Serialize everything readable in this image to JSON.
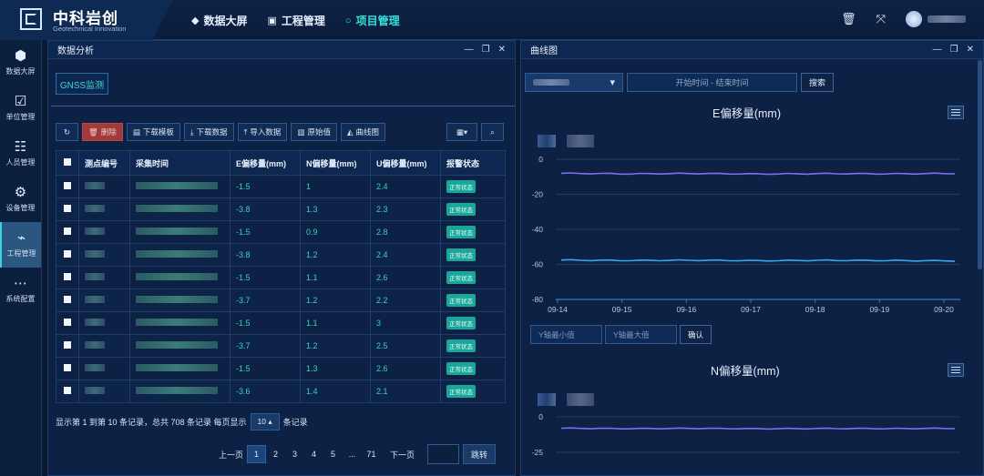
{
  "logo": {
    "title": "中科岩创",
    "subtitle": "Geotechnical Innovation"
  },
  "nav": [
    {
      "label": "数据大屏",
      "icon": "cube-icon"
    },
    {
      "label": "工程管理",
      "icon": "monitor-icon"
    },
    {
      "label": "项目管理",
      "icon": "circle-icon",
      "active": true
    }
  ],
  "sidebar": [
    {
      "label": "数据大屏",
      "icon": "cube-icon"
    },
    {
      "label": "单位管理",
      "icon": "calendar-check-icon"
    },
    {
      "label": "人员管理",
      "icon": "user-list-icon"
    },
    {
      "label": "设备管理",
      "icon": "gear-icon"
    },
    {
      "label": "工程管理",
      "icon": "chart-icon",
      "active": true
    },
    {
      "label": "系统配置",
      "icon": "more-dots-icon"
    }
  ],
  "left_panel": {
    "title": "数据分析",
    "tab": "GNSS监测",
    "toolbar": {
      "delete": "删除",
      "download_template": "下载模板",
      "download_data": "下载数据",
      "import_data": "导入数据",
      "raw_value": "原始值",
      "curve": "曲线图"
    },
    "columns": [
      "测点编号",
      "采集时间",
      "E偏移量(mm)",
      "N偏移量(mm)",
      "U偏移量(mm)",
      "报警状态"
    ],
    "rows": [
      {
        "e": "-1.5",
        "n": "1",
        "u": "2.4",
        "status": "正常状态"
      },
      {
        "e": "-3.8",
        "n": "1.3",
        "u": "2.3",
        "status": "正常状态"
      },
      {
        "e": "-1.5",
        "n": "0.9",
        "u": "2.8",
        "status": "正常状态"
      },
      {
        "e": "-3.8",
        "n": "1.2",
        "u": "2.4",
        "status": "正常状态"
      },
      {
        "e": "-1.5",
        "n": "1.1",
        "u": "2.6",
        "status": "正常状态"
      },
      {
        "e": "-3.7",
        "n": "1.2",
        "u": "2.2",
        "status": "正常状态"
      },
      {
        "e": "-1.5",
        "n": "1.1",
        "u": "3",
        "status": "正常状态"
      },
      {
        "e": "-3.7",
        "n": "1.2",
        "u": "2.5",
        "status": "正常状态"
      },
      {
        "e": "-1.5",
        "n": "1.3",
        "u": "2.6",
        "status": "正常状态"
      },
      {
        "e": "-3.6",
        "n": "1.4",
        "u": "2.1",
        "status": "正常状态"
      }
    ],
    "summary_prefix": "显示第 1 到第 10 条记录，总共 708 条记录 每页显示",
    "page_size": "10",
    "summary_suffix": "条记录",
    "pager": {
      "prev": "上一页",
      "pages": [
        "1",
        "2",
        "3",
        "4",
        "5",
        "...",
        "71"
      ],
      "next": "下一页",
      "jump": "跳转"
    }
  },
  "right_panel": {
    "title": "曲线图",
    "date_placeholder": "开始时间 - 结束时间",
    "search": "搜索",
    "y_min_placeholder": "Y轴最小值",
    "y_max_placeholder": "Y轴最大值",
    "confirm": "确认"
  },
  "chart_data": [
    {
      "type": "line",
      "title": "E偏移量(mm)",
      "x": [
        "09-14",
        "09-15",
        "09-16",
        "09-17",
        "09-18",
        "09-19",
        "09-20"
      ],
      "ylim": [
        -80,
        0
      ],
      "yticks": [
        0,
        -20,
        -40,
        -60,
        -80
      ],
      "series": [
        {
          "values": [
            -8,
            -8.3,
            -8.1,
            -8.4,
            -8.2,
            -8.3,
            -8.1
          ],
          "color": "#7f6df0"
        },
        {
          "values": [
            -57.5,
            -57.8,
            -57.6,
            -57.9,
            -57.7,
            -57.8,
            -58
          ],
          "color": "#3aa6f0"
        }
      ]
    },
    {
      "type": "line",
      "title": "N偏移量(mm)",
      "yticks": [
        0,
        -25
      ],
      "series": [
        {
          "values": [
            -8,
            -8.3,
            -8.1,
            -8.4,
            -8.2,
            -8.3,
            -8.1
          ],
          "color": "#7f6df0"
        }
      ]
    }
  ]
}
